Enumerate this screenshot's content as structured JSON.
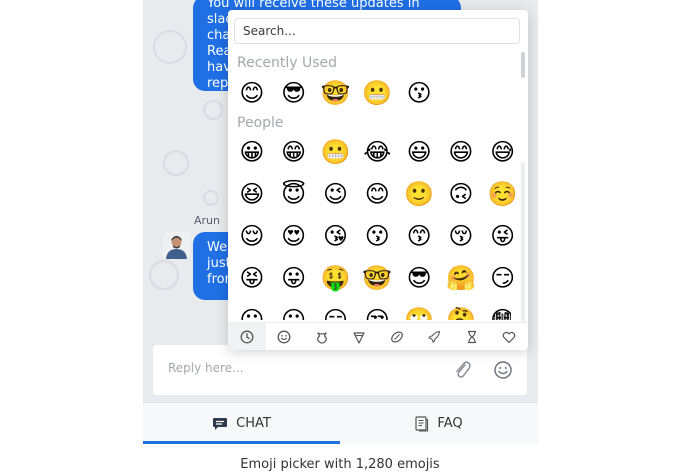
{
  "messages": {
    "first_bubble_lines": [
      "You will receive these updates in slack",
      "cha",
      "Rea",
      "hav",
      "rep"
    ],
    "sender_name": "Arun",
    "second_bubble_lines": [
      "We",
      "just",
      "from"
    ]
  },
  "emoji_picker": {
    "search_placeholder": "Search...",
    "recently_used_label": "Recently Used",
    "recently_used": [
      "😊",
      "😎",
      "🤓",
      "😬",
      "😗"
    ],
    "people_label": "People",
    "people": [
      "😀",
      "😁",
      "😬",
      "😂",
      "😃",
      "😄",
      "😅",
      "😆",
      "😇",
      "😉",
      "😊",
      "🙂",
      "🙃",
      "☺️",
      "😌",
      "😍",
      "😘",
      "😗",
      "😙",
      "😚",
      "😜",
      "😝",
      "😛",
      "🤑",
      "🤓",
      "😎",
      "🤗",
      "😏"
    ],
    "people_partial_row": [
      "😶",
      "😐",
      "😑",
      "😒",
      "🙄",
      "🤔",
      "😳"
    ],
    "category_tabs": [
      "clock-icon",
      "smiley-icon",
      "animal-icon",
      "food-icon",
      "sports-icon",
      "travel-icon",
      "objects-icon",
      "symbols-icon"
    ],
    "active_tab_index": 0
  },
  "reply": {
    "placeholder": "Reply here..."
  },
  "bottom_nav": {
    "chat_label": "CHAT",
    "faq_label": "FAQ",
    "active": "chat"
  },
  "caption": "Emoji picker with 1,280 emojis",
  "colors": {
    "accent": "#1f6fe5",
    "chat_background": "#e8eaed"
  }
}
